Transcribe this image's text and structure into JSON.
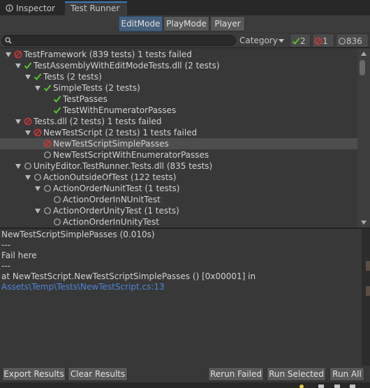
{
  "tabs": {
    "inspector": "Inspector",
    "test_runner": "Test Runner"
  },
  "modes": {
    "edit": "EditMode",
    "play": "PlayMode",
    "player": "Player",
    "selected": "EditMode"
  },
  "filter": {
    "search_placeholder": "",
    "category": "Category",
    "passed_count": "2",
    "failed_count": "1",
    "not_run_count": "836"
  },
  "tree": [
    {
      "label": "TestFramework (839 tests)  1 tests failed",
      "status": "failed",
      "depth": 0,
      "expanded": true
    },
    {
      "label": "TestAssemblyWithEditModeTests.dll (2 tests)",
      "status": "passed",
      "depth": 1,
      "expanded": true
    },
    {
      "label": "Tests (2 tests)",
      "status": "passed",
      "depth": 2,
      "expanded": true
    },
    {
      "label": "SimpleTests (2 tests)",
      "status": "passed",
      "depth": 3,
      "expanded": true
    },
    {
      "label": "TestPasses",
      "status": "passed",
      "depth": 4,
      "expanded": null
    },
    {
      "label": "TestWithEnumeratorPasses",
      "status": "passed",
      "depth": 4,
      "expanded": null
    },
    {
      "label": "Tests.dll (2 tests)  1 tests failed",
      "status": "failed",
      "depth": 1,
      "expanded": true
    },
    {
      "label": "NewTestScript (2 tests)  1 tests failed",
      "status": "failed",
      "depth": 2,
      "expanded": true
    },
    {
      "label": "NewTestScriptSimplePasses",
      "status": "failed",
      "depth": 3,
      "expanded": null,
      "selected": true
    },
    {
      "label": "NewTestScriptWithEnumeratorPasses",
      "status": "none",
      "depth": 3,
      "expanded": null
    },
    {
      "label": "UnityEditor.TestRunner.Tests.dll (835 tests)",
      "status": "none",
      "depth": 1,
      "expanded": true
    },
    {
      "label": "ActionOutsideOfTest (122 tests)",
      "status": "none",
      "depth": 2,
      "expanded": true
    },
    {
      "label": "ActionOrderNunitTest (1 tests)",
      "status": "none",
      "depth": 3,
      "expanded": true
    },
    {
      "label": "ActionOrderInNUnitTest",
      "status": "none",
      "depth": 4,
      "expanded": null
    },
    {
      "label": "ActionOrderUnityTest (1 tests)",
      "status": "none",
      "depth": 3,
      "expanded": true
    },
    {
      "label": "ActionOrderInUnityTest",
      "status": "none",
      "depth": 4,
      "expanded": null
    }
  ],
  "details": {
    "title": "NewTestScriptSimplePasses (0.010s)",
    "sep1": "---",
    "message": "Fail here",
    "sep2": "---",
    "stack": "at NewTestScript.NewTestScriptSimplePasses () [0x00001] in",
    "path": "Assets\\Temp\\Tests\\NewTestScript.cs:13"
  },
  "buttons": {
    "export": "Export Results",
    "clear": "Clear Results",
    "rerun_failed": "Rerun Failed",
    "run_selected": "Run Selected",
    "run_all": "Run All"
  },
  "colors": {
    "passed": "#57c232",
    "failed": "#c8373b",
    "accent": "#3a79bb",
    "link": "#4c86d8"
  }
}
